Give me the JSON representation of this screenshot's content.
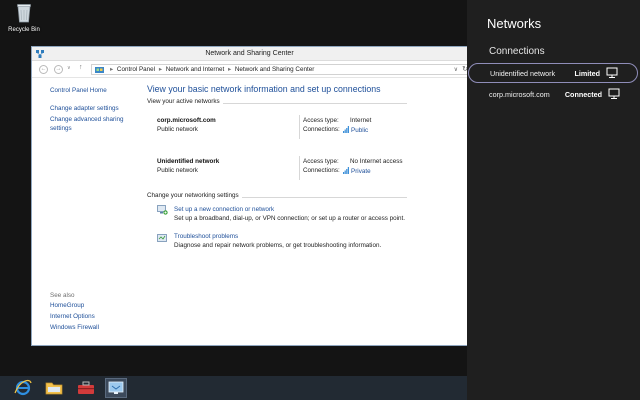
{
  "desktop": {
    "recycle_bin_label": "Recycle Bin"
  },
  "window": {
    "title": "Network and Sharing Center",
    "nav": {
      "back": "←",
      "forward": "→",
      "dropdown": "∨",
      "up": "↑",
      "address_dropdown": "∨",
      "refresh": "↻"
    },
    "breadcrumb": [
      "Control Panel",
      "Network and Internet",
      "Network and Sharing Center"
    ],
    "breadcrumb_sep": "▸",
    "left_pane": {
      "home": "Control Panel Home",
      "change_adapter": "Change adapter settings",
      "change_advanced_line1": "Change advanced sharing",
      "change_advanced_line2": "settings",
      "see_also_title": "See also",
      "see_also": [
        "HomeGroup",
        "Internet Options",
        "Windows Firewall"
      ]
    },
    "main": {
      "heading": "View your basic network information and set up connections",
      "active_networks_label": "View your active networks",
      "access_type_label": "Access type:",
      "connections_label": "Connections:",
      "networks": [
        {
          "name": "corp.microsoft.com",
          "type": "Public network",
          "access_type": "Internet",
          "connection": "Public"
        },
        {
          "name": "Unidentified network",
          "type": "Public network",
          "access_type": "No Internet access",
          "connection": "Private"
        }
      ],
      "change_settings_label": "Change your networking settings",
      "tasks": [
        {
          "title": "Set up a new connection or network",
          "desc": "Set up a broadband, dial-up, or VPN connection; or set up a router or access point."
        },
        {
          "title": "Troubleshoot problems",
          "desc": "Diagnose and repair network problems, or get troubleshooting information."
        }
      ]
    }
  },
  "charm": {
    "title": "Networks",
    "subtitle": "Connections",
    "items": [
      {
        "name": "Unidentified network",
        "status": "Limited"
      },
      {
        "name": "corp.microsoft.com",
        "status": "Connected"
      }
    ]
  },
  "taskbar": {
    "items": [
      "internet-explorer",
      "file-explorer",
      "toolbox",
      "network-and-sharing-center"
    ]
  },
  "colors": {
    "link": "#1e4f99",
    "charm_bg": "#1f1f1f",
    "taskbar_bg": "#222a33",
    "selection_outline": "#8f8db9"
  }
}
